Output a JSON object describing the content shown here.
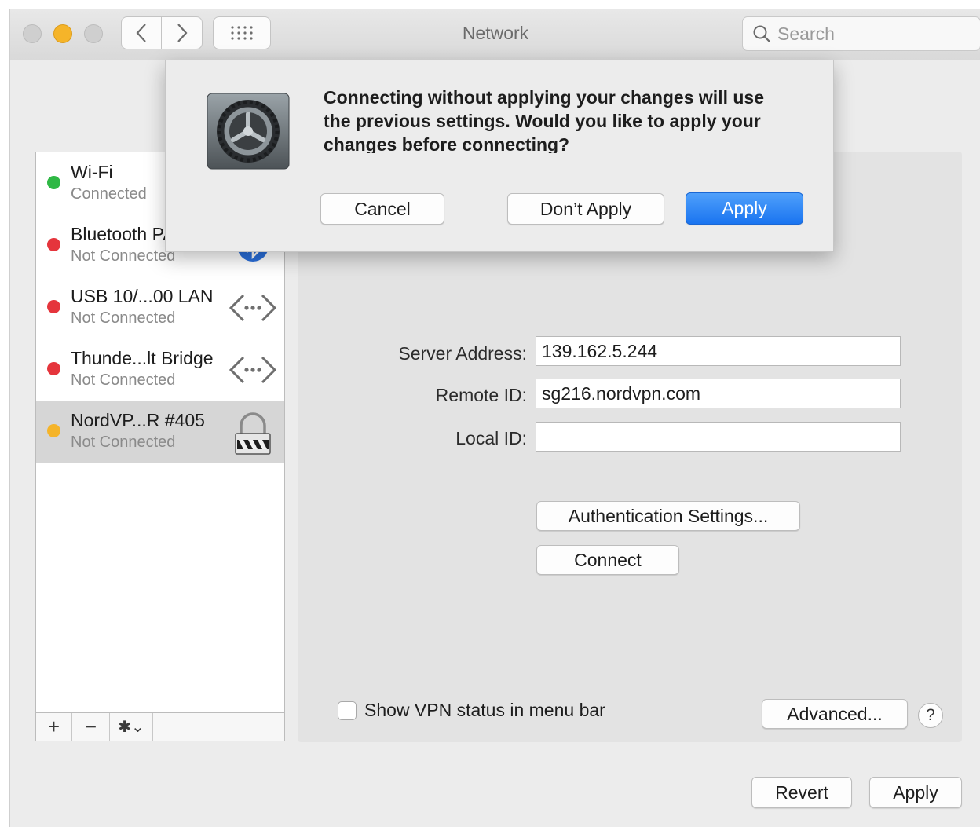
{
  "window": {
    "title": "Network",
    "search_placeholder": "Search"
  },
  "services": [
    {
      "name": "Wi-Fi",
      "status": "Connected",
      "status_color": "#2fb845",
      "icon": "none",
      "selected": false
    },
    {
      "name": "Bluetooth PAN",
      "status": "Not Connected",
      "status_color": "#e5353c",
      "icon": "bluetooth-icon",
      "selected": false
    },
    {
      "name": "USB 10/...00 LAN",
      "status": "Not Connected",
      "status_color": "#e5353c",
      "icon": "ethernet-arrows-icon",
      "selected": false
    },
    {
      "name": "Thunde...lt Bridge",
      "status": "Not Connected",
      "status_color": "#e5353c",
      "icon": "ethernet-arrows-icon",
      "selected": false
    },
    {
      "name": "NordVP...R #405",
      "status": "Not Connected",
      "status_color": "#f5b429",
      "icon": "vpn-lock-icon",
      "selected": true
    }
  ],
  "sidebar_controls": {
    "add": "+",
    "remove": "−",
    "gear": "✱⌄"
  },
  "vpn": {
    "server_address_label": "Server Address:",
    "server_address_value": "139.162.5.244",
    "remote_id_label": "Remote ID:",
    "remote_id_value": "sg216.nordvpn.com",
    "local_id_label": "Local ID:",
    "local_id_value": "",
    "auth_button": "Authentication Settings...",
    "connect_button": "Connect",
    "show_status_label": "Show VPN status in menu bar",
    "show_status_checked": false,
    "advanced_button": "Advanced...",
    "help_button": "?"
  },
  "footer": {
    "revert_button": "Revert",
    "apply_button": "Apply"
  },
  "dialog": {
    "message": "Connecting without applying your changes will use the previous settings. Would you like to apply your changes before connecting?",
    "cancel_button": "Cancel",
    "dont_apply_button": "Don’t Apply",
    "apply_button": "Apply",
    "icon": "system-preferences-gear-icon"
  },
  "colors": {
    "accent": "#1a74f0",
    "connected": "#2fb845",
    "disconnected": "#e5353c",
    "inactive": "#f5b429"
  }
}
